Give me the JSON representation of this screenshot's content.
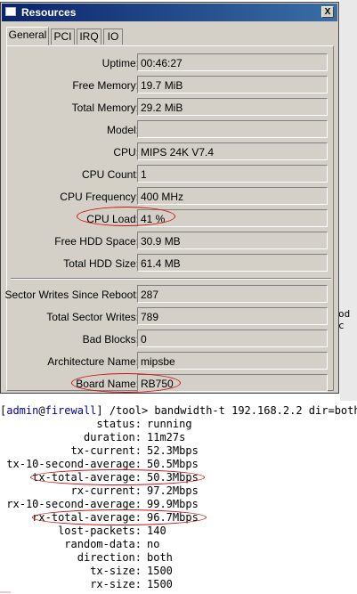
{
  "window": {
    "title": "Resources",
    "close_glyph": "X",
    "tabs": [
      "General",
      "PCI",
      "IRQ",
      "IO"
    ]
  },
  "fields": [
    {
      "label": "Uptime:",
      "value": "00:46:27"
    },
    {
      "label": "Free Memory:",
      "value": "19.7 MiB"
    },
    {
      "label": "Total Memory:",
      "value": "29.2 MiB"
    },
    {
      "label": "Model:",
      "value": ""
    },
    {
      "label": "CPU:",
      "value": "MIPS 24K V7.4"
    },
    {
      "label": "CPU Count:",
      "value": "1"
    },
    {
      "label": "CPU Frequency:",
      "value": "400 MHz"
    },
    {
      "label": "CPU Load:",
      "value": "41 %"
    },
    {
      "label": "Free HDD Space:",
      "value": "30.9 MB"
    },
    {
      "label": "Total HDD Size:",
      "value": "61.4 MB"
    },
    {
      "label": "Sector Writes Since Reboot:",
      "value": "287"
    },
    {
      "label": "Total Sector Writes:",
      "value": "789"
    },
    {
      "label": "Bad Blocks:",
      "value": "0"
    },
    {
      "label": "Architecture Name:",
      "value": "mipsbe"
    },
    {
      "label": "Board Name:",
      "value": "RB750"
    }
  ],
  "background": {
    "stray_text": "od c"
  },
  "terminal": {
    "prompt_open": "[",
    "user": "admin",
    "at": "@",
    "host": "firewall",
    "prompt_close": "] /tool>",
    "command": " bandwidth-t 192.168.2.2 dir=both",
    "rows": [
      {
        "key": "status:",
        "value": "running"
      },
      {
        "key": "duration:",
        "value": "11m27s"
      },
      {
        "key": "tx-current:",
        "value": "52.3Mbps"
      },
      {
        "key": "tx-10-second-average:",
        "value": "50.5Mbps"
      },
      {
        "key": "tx-total-average:",
        "value": "50.3Mbps"
      },
      {
        "key": "rx-current:",
        "value": "97.2Mbps"
      },
      {
        "key": "rx-10-second-average:",
        "value": "99.9Mbps"
      },
      {
        "key": "rx-total-average:",
        "value": "96.7Mbps"
      },
      {
        "key": "lost-packets:",
        "value": "140"
      },
      {
        "key": "random-data:",
        "value": "no"
      },
      {
        "key": "direction:",
        "value": "both"
      },
      {
        "key": "tx-size:",
        "value": "1500"
      },
      {
        "key": "rx-size:",
        "value": "1500"
      }
    ]
  },
  "colors": {
    "title_bar": "#0a246a",
    "window_bg": "#d4d0c8",
    "highlight_oval": "#d01010",
    "terminal_user": "#0000a0"
  }
}
